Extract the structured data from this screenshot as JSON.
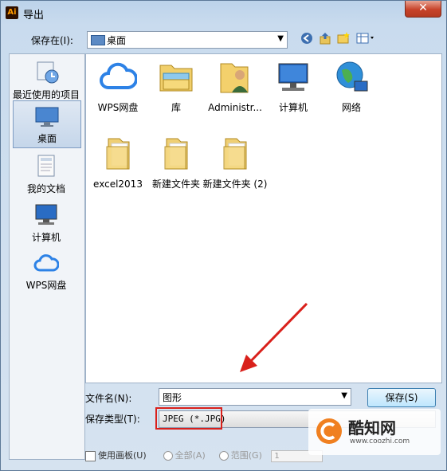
{
  "window": {
    "title": "导出",
    "app_icon": "Ai",
    "close_glyph": "✕"
  },
  "toolbar": {
    "save_in_label": "保存在(I):",
    "location_value": "桌面"
  },
  "places": [
    {
      "label": "最近使用的项目",
      "icon": "recent-icon"
    },
    {
      "label": "桌面",
      "icon": "desktop-icon"
    },
    {
      "label": "我的文档",
      "icon": "documents-icon"
    },
    {
      "label": "计算机",
      "icon": "computer-icon"
    },
    {
      "label": "WPS网盘",
      "icon": "cloud-icon"
    }
  ],
  "files": [
    {
      "label": "WPS网盘",
      "icon": "cloud-icon"
    },
    {
      "label": "库",
      "icon": "library-icon"
    },
    {
      "label": "Administr...",
      "icon": "user-folder-icon"
    },
    {
      "label": "计算机",
      "icon": "computer-icon"
    },
    {
      "label": "网络",
      "icon": "network-icon"
    },
    {
      "label": "excel2013",
      "icon": "folder-icon"
    },
    {
      "label": "新建文件夹",
      "icon": "folder-icon"
    },
    {
      "label": "新建文件夹 (2)",
      "icon": "folder-icon"
    }
  ],
  "form": {
    "filename_label": "文件名(N):",
    "filename_value": "图形",
    "filetype_label": "保存类型(T):",
    "filetype_value": "JPEG (*.JPG)",
    "save_button": "保存(S)"
  },
  "options": {
    "use_artboards": "使用画板(U)",
    "all": "全部(A)",
    "range": "范围(G)",
    "range_value": "1"
  },
  "watermark": {
    "brand": "酷知网",
    "url": "www.coozhi.com"
  },
  "colors": {
    "annotation": "#d9201b",
    "selection": "#c5d6ea"
  }
}
